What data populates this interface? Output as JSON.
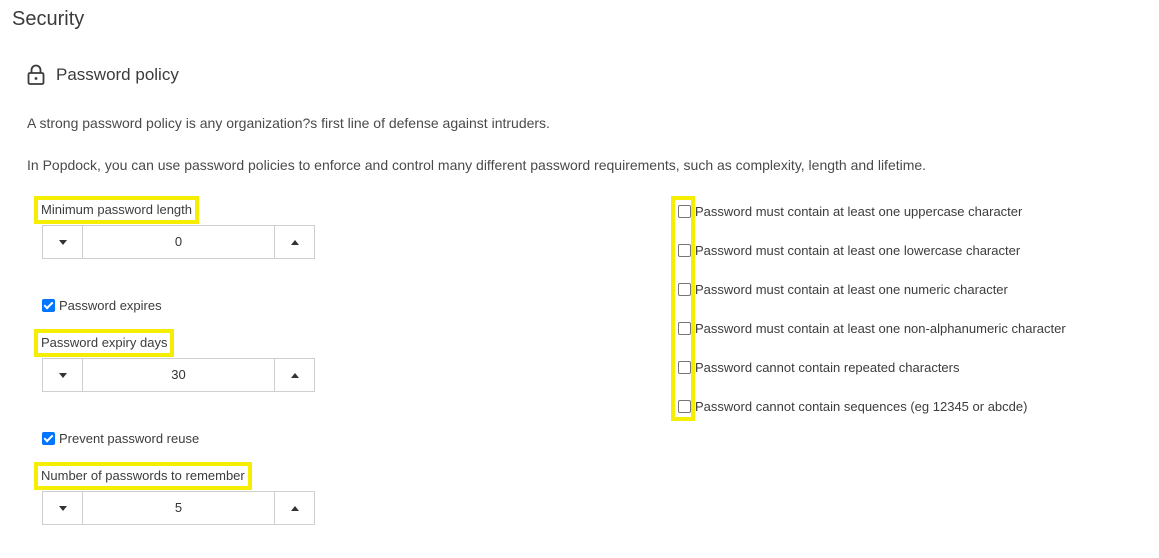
{
  "page": {
    "title": "Security"
  },
  "section": {
    "title": "Password policy",
    "icon": "lock-icon",
    "description_1": "A strong password policy is any organization?s first line of defense against intruders.",
    "description_2": "In Popdock, you can use password policies to enforce and control many different password requirements, such as complexity, length and lifetime."
  },
  "min_length": {
    "label": "Minimum password length",
    "value": "0"
  },
  "expires": {
    "label": "Password expires",
    "checked": true
  },
  "expiry_days": {
    "label": "Password expiry days",
    "value": "30"
  },
  "reuse": {
    "label": "Prevent password reuse",
    "checked": true
  },
  "remember_count": {
    "label": "Number of passwords to remember",
    "value": "5"
  },
  "rules": [
    {
      "label": "Password must contain at least one uppercase character",
      "checked": false
    },
    {
      "label": "Password must contain at least one lowercase character",
      "checked": false
    },
    {
      "label": "Password must contain at least one numeric character",
      "checked": false
    },
    {
      "label": "Password must contain at least one non-alphanumeric character",
      "checked": false
    },
    {
      "label": "Password cannot contain repeated characters",
      "checked": false
    },
    {
      "label": "Password cannot contain sequences (eg 12345 or abcde)",
      "checked": false
    }
  ],
  "colors": {
    "highlight": "#f5ee00",
    "checkbox_checked": "#0075ff"
  }
}
